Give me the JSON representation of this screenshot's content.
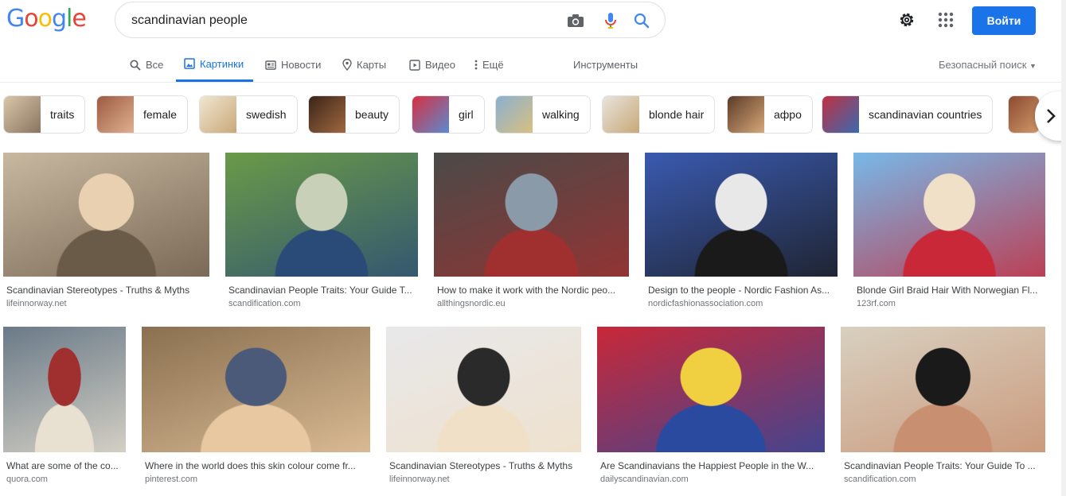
{
  "logo": {
    "letters": [
      "G",
      "o",
      "o",
      "g",
      "l",
      "e"
    ],
    "colors": [
      "#4285f4",
      "#ea4335",
      "#fbbc05",
      "#4285f4",
      "#34a853",
      "#ea4335"
    ]
  },
  "search": {
    "value": "scandinavian people",
    "icons": [
      "camera-icon",
      "mic-icon",
      "search-icon"
    ]
  },
  "header": {
    "signin_label": "Войти",
    "settings_icon": "gear-icon",
    "apps_icon": "apps-grid-icon",
    "accent": "#1a73e8"
  },
  "tabs": [
    {
      "label": "Все",
      "icon": "search-icon",
      "active": false
    },
    {
      "label": "Картинки",
      "icon": "image-icon",
      "active": true
    },
    {
      "label": "Новости",
      "icon": "news-icon",
      "active": false
    },
    {
      "label": "Карты",
      "icon": "pin-icon",
      "active": false
    },
    {
      "label": "Видео",
      "icon": "play-icon",
      "active": false
    },
    {
      "label": "Ещё",
      "icon": "more-vert-icon",
      "active": false
    }
  ],
  "tools_label": "Инструменты",
  "safe_search_label": "Безопасный поиск",
  "chips": [
    {
      "label": "traits",
      "thumb": [
        "#d9c6a8",
        "#8a7460"
      ]
    },
    {
      "label": "female",
      "thumb": [
        "#9c5a40",
        "#e0b090"
      ]
    },
    {
      "label": "swedish",
      "thumb": [
        "#f0e6d2",
        "#c9a878"
      ]
    },
    {
      "label": "beauty",
      "thumb": [
        "#3a2418",
        "#a06840"
      ]
    },
    {
      "label": "girl",
      "thumb": [
        "#d83040",
        "#5a8ad0"
      ]
    },
    {
      "label": "walking",
      "thumb": [
        "#8ab0d0",
        "#d8c080"
      ]
    },
    {
      "label": "blonde hair",
      "thumb": [
        "#e8e4dc",
        "#c8a878"
      ]
    },
    {
      "label": "афро",
      "thumb": [
        "#5a3a28",
        "#d8a878"
      ]
    },
    {
      "label": "scandinavian countries",
      "thumb": [
        "#c03040",
        "#3a6ab0"
      ]
    },
    {
      "label": "",
      "thumb": [
        "#8a4a30",
        "#d8a070"
      ]
    }
  ],
  "results": [
    {
      "title": "Scandinavian Stereotypes - Truths & Myths",
      "source": "lifeinnorway.net",
      "colors": [
        "#c8b8a0",
        "#6a5a48",
        "#e8d0b0"
      ]
    },
    {
      "title": "Scandinavian People Traits: Your Guide T...",
      "source": "scandification.com",
      "colors": [
        "#6a9a48",
        "#2a4a78",
        "#c8d0b8"
      ]
    },
    {
      "title": "How to make it work with the Nordic peo...",
      "source": "allthingsnordic.eu",
      "colors": [
        "#4a4a48",
        "#a03030",
        "#8a9aa8"
      ]
    },
    {
      "title": "Design to the people - Nordic Fashion As...",
      "source": "nordicfashionassociation.com",
      "colors": [
        "#3a5ab0",
        "#1a1a1a",
        "#e8e8e8"
      ]
    },
    {
      "title": "Blonde Girl Braid Hair With Norwegian Fl...",
      "source": "123rf.com",
      "colors": [
        "#78b8e8",
        "#c82838",
        "#f0e0c8"
      ]
    },
    {
      "title": "What are some of the co...",
      "source": "quora.com",
      "colors": [
        "#6a7a88",
        "#e8e0d0",
        "#a03030"
      ]
    },
    {
      "title": "Where in the world does this skin colour come fr...",
      "source": "pinterest.com",
      "colors": [
        "#8a7050",
        "#e8c8a0",
        "#4a5a78"
      ]
    },
    {
      "title": "Scandinavian Stereotypes - Truths & Myths",
      "source": "lifeinnorway.net",
      "colors": [
        "#e8e8ea",
        "#f0e0c8",
        "#2a2a2a"
      ]
    },
    {
      "title": "Are Scandinavians the Happiest People in the W...",
      "source": "dailyscandinavian.com",
      "colors": [
        "#c82838",
        "#2a4aa0",
        "#f0d040"
      ]
    },
    {
      "title": "Scandinavian People Traits: Your Guide To ...",
      "source": "scandification.com",
      "colors": [
        "#d8d0c0",
        "#c89070",
        "#1a1a1a"
      ]
    }
  ]
}
